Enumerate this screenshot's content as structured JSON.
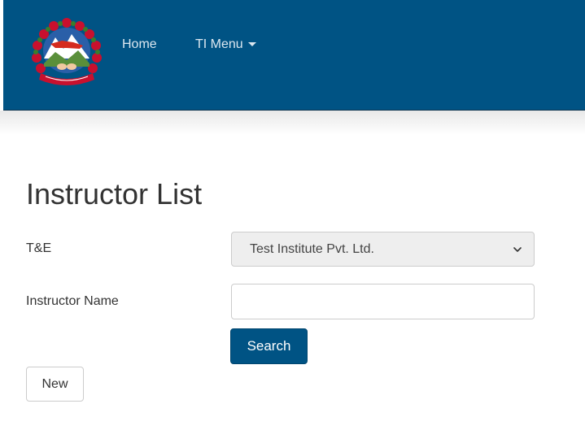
{
  "nav": {
    "home_label": "Home",
    "ti_menu_label": "TI Menu",
    "logo_icon": "nepal-emblem-icon",
    "caret_icon": "caret-down-icon"
  },
  "page": {
    "title": "Instructor List"
  },
  "form": {
    "te_label": "T&E",
    "te_selected": "Test Institute Pvt. Ltd.",
    "instructor_name_label": "Instructor Name",
    "instructor_name_value": "",
    "instructor_name_placeholder": ""
  },
  "buttons": {
    "search_label": "Search",
    "new_label": "New"
  },
  "colors": {
    "navbar": "#005384",
    "primary_button": "#005384",
    "select_background": "#eeeeee"
  }
}
